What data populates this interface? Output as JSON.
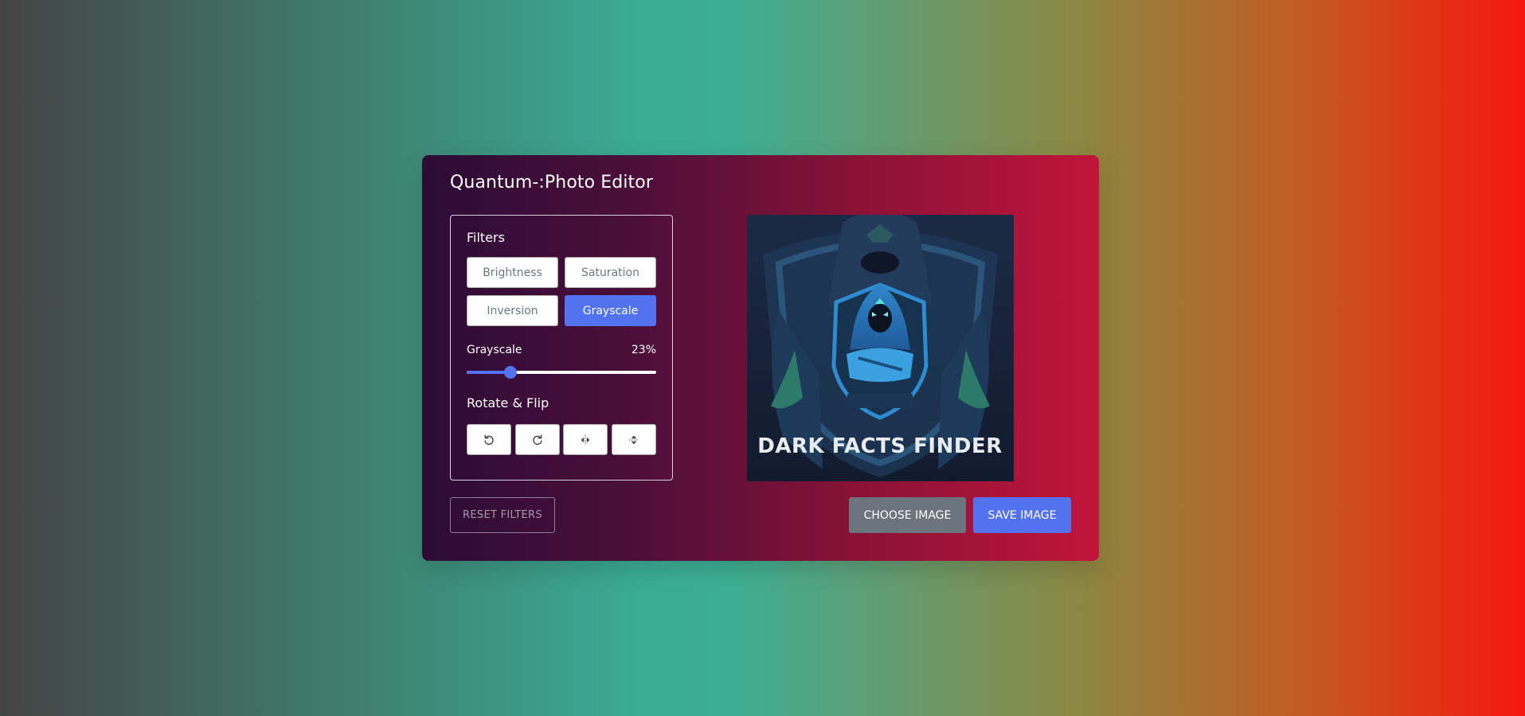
{
  "app": {
    "title": "Quantum-:Photo Editor"
  },
  "filters": {
    "heading": "Filters",
    "buttons": [
      {
        "label": "Brightness",
        "active": false
      },
      {
        "label": "Saturation",
        "active": false
      },
      {
        "label": "Inversion",
        "active": false
      },
      {
        "label": "Grayscale",
        "active": true
      }
    ]
  },
  "slider": {
    "name": "Grayscale",
    "value_text": "23%",
    "value": 23,
    "max": 100
  },
  "rotate": {
    "heading": "Rotate & Flip",
    "buttons": [
      {
        "icon": "rotate-left-icon"
      },
      {
        "icon": "rotate-right-icon"
      },
      {
        "icon": "flip-horizontal-icon"
      },
      {
        "icon": "flip-vertical-icon"
      }
    ]
  },
  "preview": {
    "image_text": "DARK FACTS FINDER"
  },
  "actions": {
    "reset_label": "RESET FILTERS",
    "choose_label": "CHOOSE IMAGE",
    "save_label": "SAVE IMAGE"
  },
  "colors": {
    "accent": "#5372f0",
    "secondary": "#6c757d"
  }
}
